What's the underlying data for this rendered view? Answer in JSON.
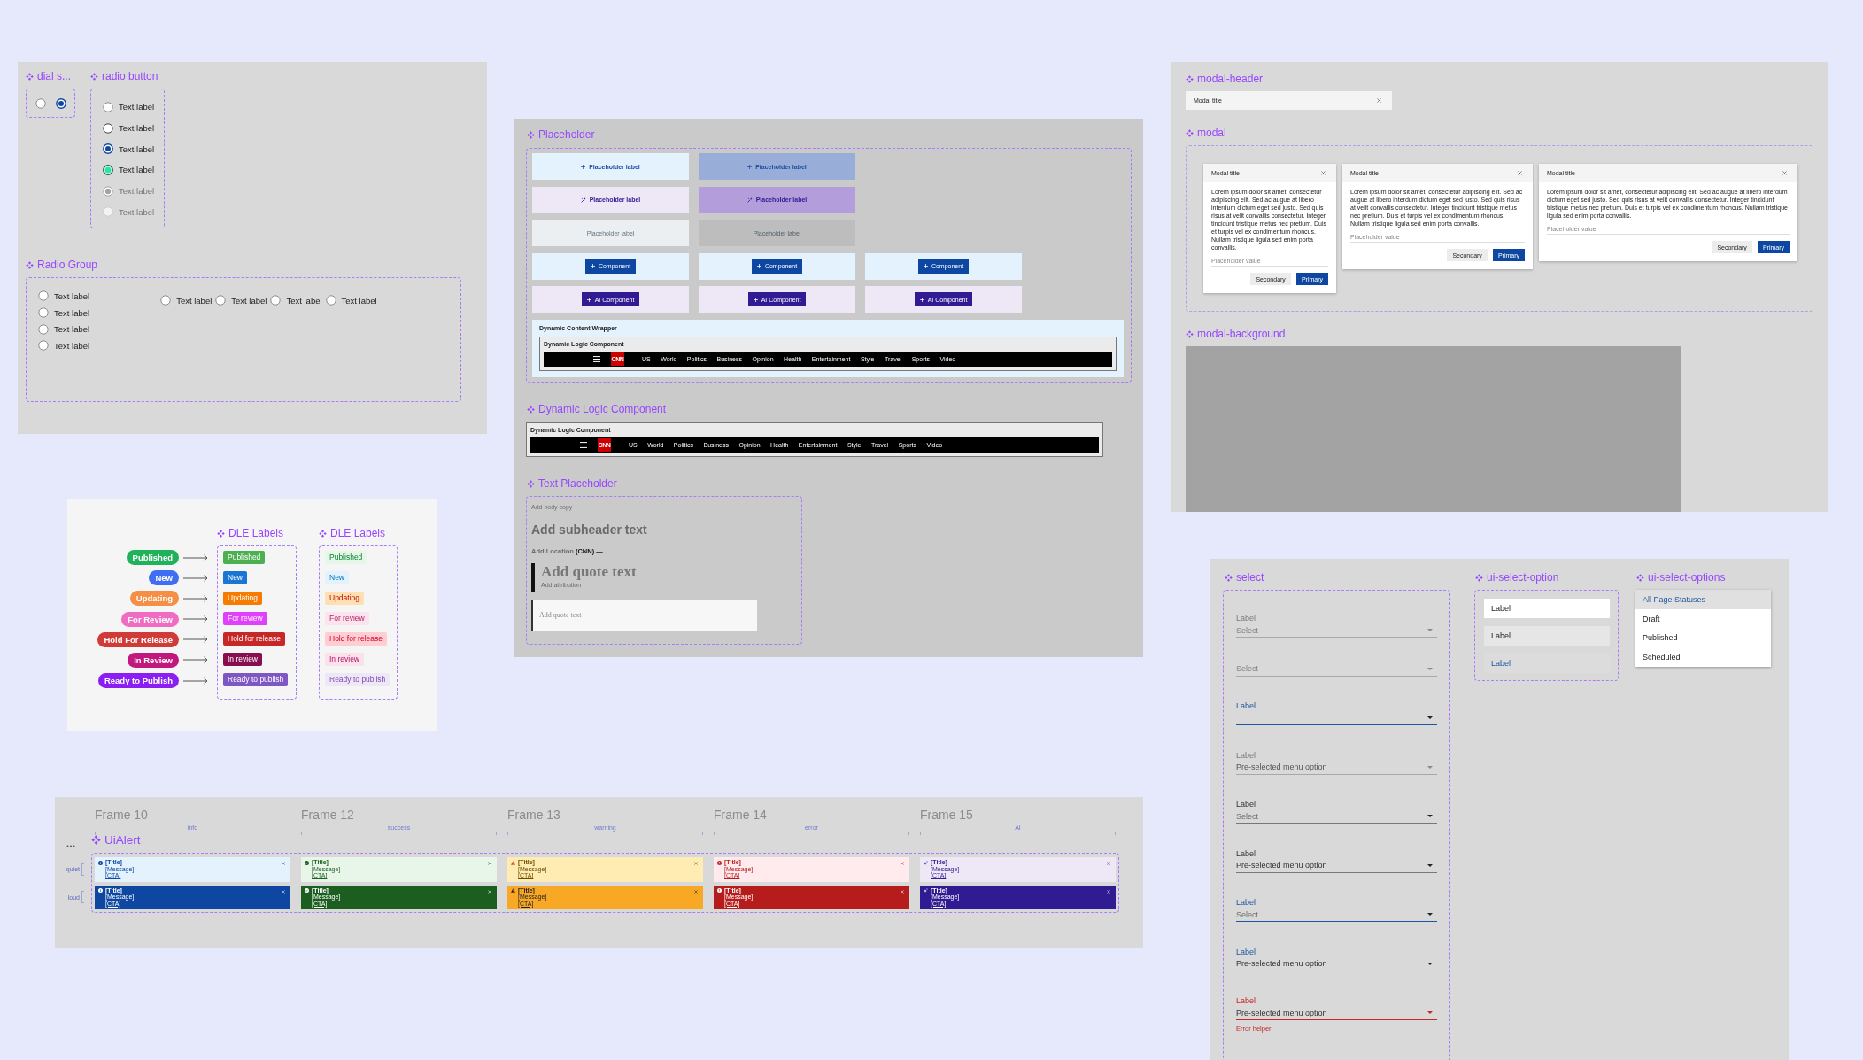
{
  "radio_frame": {
    "dial": {
      "title": "dial s...",
      "radios": [
        {
          "selected": false
        },
        {
          "selected": true
        }
      ]
    },
    "radio_button": {
      "title": "radio button",
      "items": [
        {
          "label": "Text label",
          "kind": "default",
          "selected": false,
          "disabled": false
        },
        {
          "label": "Text label",
          "kind": "hover",
          "selected": false,
          "disabled": false
        },
        {
          "label": "Text label",
          "kind": "default",
          "selected": true,
          "disabled": false
        },
        {
          "label": "Text label",
          "kind": "success",
          "selected": true,
          "disabled": false
        },
        {
          "label": "Text label",
          "kind": "default",
          "selected": true,
          "disabled": true
        },
        {
          "label": "Text label",
          "kind": "default",
          "selected": false,
          "disabled": true
        }
      ]
    },
    "radio_group": {
      "title": "Radio Group",
      "vertical": [
        {
          "label": "Text label",
          "selected": false
        },
        {
          "label": "Text label",
          "selected": false
        },
        {
          "label": "Text label",
          "selected": false
        },
        {
          "label": "Text label",
          "selected": false
        }
      ],
      "horizontal": [
        {
          "label": "Text label",
          "selected": false
        },
        {
          "label": "Text label",
          "selected": false
        },
        {
          "label": "Text label",
          "selected": false
        },
        {
          "label": "Text label",
          "selected": false
        }
      ]
    }
  },
  "modal_frame": {
    "header_section": {
      "title": "modal-header",
      "header": {
        "title": "Modal title"
      }
    },
    "modal_section": {
      "title": "modal",
      "modals": [
        {
          "title": "Modal title",
          "body": "Lorem ipsum dolor sit amet, consectetur adipiscing elit. Sed ac augue at libero interdum dictum eget sed justo. Sed quis risus at velit convallis consectetur. Integer tincidunt tristique metus nec pretium. Duis et turpis vel ex condimentum rhoncus. Nullam tristique ligula sed enim porta convallis.",
          "field": {
            "placeholder": "Placeholder value"
          },
          "buttons": [
            {
              "label": "Secondary",
              "kind": "secondary"
            },
            {
              "label": "Primary",
              "kind": "primary"
            }
          ]
        },
        {
          "title": "Modal title",
          "body": "Lorem ipsum dolor sit amet, consectetur adipiscing elit. Sed ac augue at libero interdum dictum eget sed justo. Sed quis risus at velit convallis consectetur. Integer tincidunt tristique metus nec pretium. Duis et turpis vel ex condimentum rhoncus. Nullam tristique ligula sed enim porta convallis.",
          "field": {
            "placeholder": "Placeholder value"
          },
          "buttons": [
            {
              "label": "Secondary",
              "kind": "secondary"
            },
            {
              "label": "Primary",
              "kind": "primary"
            }
          ]
        },
        {
          "title": "Modal title",
          "body": "Lorem ipsum dolor sit amet, consectetur adipiscing elit. Sed ac augue at libero interdum dictum eget sed justo. Sed quis risus at velit convallis consectetur. Integer tincidunt tristique metus nec pretium. Duis et turpis vel ex condimentum rhoncus. Nullam tristique ligula sed enim porta convallis.",
          "field": {
            "placeholder": "Placeholder value"
          },
          "buttons": [
            {
              "label": "Secondary",
              "kind": "secondary"
            },
            {
              "label": "Primary",
              "kind": "primary"
            }
          ]
        }
      ]
    },
    "background_section": {
      "title": "modal-background"
    }
  },
  "placeholder_frame": {
    "placeholder": {
      "title": "Placeholder",
      "rows": [
        [
          {
            "kind": "add",
            "label": "Placeholder label",
            "active": false
          },
          {
            "kind": "add",
            "label": "Placeholder label",
            "active": true
          }
        ],
        [
          {
            "kind": "ai",
            "label": "Placeholder label",
            "active": false
          },
          {
            "kind": "ai",
            "label": "Placeholder label",
            "active": true
          }
        ],
        [
          {
            "kind": "plain",
            "label": "Placeholder label",
            "active": false
          },
          {
            "kind": "plain",
            "label": "Placeholder label",
            "active": true
          }
        ],
        [
          {
            "kind": "component",
            "label": "Component",
            "active": false
          },
          {
            "kind": "component",
            "label": "Component",
            "active": false
          },
          {
            "kind": "component",
            "label": "Component",
            "active": false
          }
        ],
        [
          {
            "kind": "ai-component",
            "label": "AI Component",
            "active": false
          },
          {
            "kind": "ai-component",
            "label": "AI Component",
            "active": false
          },
          {
            "kind": "ai-component",
            "label": "AI Component",
            "active": false
          }
        ]
      ],
      "wrapper": {
        "title": "Dynamic Content Wrapper",
        "component": {
          "title": "Dynamic Logic Component",
          "logo": "CNN",
          "nav": [
            "US",
            "World",
            "Politics",
            "Business",
            "Opinion",
            "Health",
            "Entertainment",
            "Style",
            "Travel",
            "Sports",
            "Video"
          ]
        }
      }
    },
    "dynamic_logic": {
      "title": "Dynamic Logic Component",
      "component": {
        "title": "Dynamic Logic Component",
        "logo": "CNN",
        "nav": [
          "US",
          "World",
          "Politics",
          "Business",
          "Opinion",
          "Health",
          "Entertainment",
          "Style",
          "Travel",
          "Sports",
          "Video"
        ]
      }
    },
    "text_placeholder": {
      "title": "Text Placeholder",
      "body": {
        "placeholder": "Add body copy"
      },
      "subheader": {
        "placeholder": "Add subheader text"
      },
      "location": {
        "placeholder": "Add Location"
      },
      "dateline": "(CNN) —",
      "quote": {
        "placeholder": "Add quote text"
      },
      "attribution": {
        "placeholder": "Add attribution"
      },
      "quote_field": {
        "placeholder": "Add quote text"
      }
    }
  },
  "status_labels": {
    "pills": [
      {
        "label": "Published",
        "color": "#1fb25a"
      },
      {
        "label": "New",
        "color": "#3f6ef3"
      },
      {
        "label": "Updating",
        "color": "#f58f45"
      },
      {
        "label": "For Review",
        "color": "#f06cc3"
      },
      {
        "label": "Hold For Release",
        "color": "#d03a37"
      },
      {
        "label": "In Review",
        "color": "#c2187e"
      },
      {
        "label": "Ready to Publish",
        "color": "#8b1ef2"
      }
    ],
    "groups": [
      {
        "title": "DLE Labels",
        "kind": "solid",
        "labels": [
          {
            "label": "Published",
            "color": "#4caf50"
          },
          {
            "label": "New",
            "color": "#1976d2"
          },
          {
            "label": "Updating",
            "color": "#f57c00"
          },
          {
            "label": "For review",
            "color": "#e040fb"
          },
          {
            "label": "Hold for release",
            "color": "#c62828"
          },
          {
            "label": "In review",
            "color": "#880e4f"
          },
          {
            "label": "Ready to publish",
            "color": "#7e57c2"
          }
        ]
      },
      {
        "title": "DLE Labels",
        "kind": "subtle",
        "labels": [
          {
            "label": "Published",
            "color": "#e8f5e9"
          },
          {
            "label": "New",
            "color": "#e3f2fd"
          },
          {
            "label": "Updating",
            "color": "#ffe0b2"
          },
          {
            "label": "For review",
            "color": "#fce4ec"
          },
          {
            "label": "Hold for release",
            "color": "#ffcdd2"
          },
          {
            "label": "In review",
            "color": "#fbe1ea"
          },
          {
            "label": "Ready to publish",
            "color": "#ede7f6"
          }
        ]
      }
    ]
  },
  "select_frame": {
    "select": {
      "title": "select",
      "fields": [
        {
          "label": "Label",
          "placeholder": "Select",
          "disabled": true,
          "focused": false,
          "error": false
        },
        {
          "placeholder": "Select",
          "disabled": true,
          "focused": false,
          "error": false
        },
        {
          "label": "Label",
          "disabled": false,
          "focused": true,
          "error": false
        },
        {
          "label": "Label",
          "value": "Pre-selected menu option",
          "disabled": true,
          "focused": false,
          "error": false
        },
        {
          "label": "Label",
          "placeholder": "Select",
          "disabled": false,
          "focused": false,
          "error": false
        },
        {
          "label": "Label",
          "value": "Pre-selected menu option",
          "disabled": false,
          "focused": false,
          "error": false
        },
        {
          "label": "Label",
          "placeholder": "Select",
          "disabled": false,
          "focused": true,
          "error": false
        },
        {
          "label": "Label",
          "value": "Pre-selected menu option",
          "disabled": false,
          "focused": true,
          "error": false
        },
        {
          "label": "Label",
          "value": "Pre-selected menu option",
          "disabled": false,
          "focused": false,
          "error": true,
          "helper": "Error helper"
        }
      ]
    },
    "option": {
      "title": "ui-select-option",
      "options": [
        {
          "label": "Label",
          "selected": false,
          "hovered": false
        },
        {
          "label": "Label",
          "selected": false,
          "hovered": true
        },
        {
          "label": "Label",
          "selected": true,
          "hovered": false
        }
      ]
    },
    "options": {
      "title": "ui-select-options",
      "items": [
        {
          "label": "All Page Statuses",
          "selected": true
        },
        {
          "label": "Draft",
          "selected": false
        },
        {
          "label": "Published",
          "selected": false
        },
        {
          "label": "Scheduled",
          "selected": false
        }
      ]
    }
  },
  "alerts_frame": {
    "frames": [
      {
        "title": "Frame 10",
        "tag": "info"
      },
      {
        "title": "Frame 12",
        "tag": "success"
      },
      {
        "title": "Frame 13",
        "tag": "warning"
      },
      {
        "title": "Frame 14",
        "tag": "error"
      },
      {
        "title": "Frame 15",
        "tag": "AI"
      }
    ],
    "title": "UiAlert",
    "rows": [
      {
        "label": "quiet",
        "kind": "quiet",
        "alerts": [
          {
            "kind": "info",
            "title": "[Title]",
            "message": "[Message]",
            "cta": "[CTA]"
          },
          {
            "kind": "success",
            "title": "[Title]",
            "message": "[Message]",
            "cta": "[CTA]"
          },
          {
            "kind": "warning",
            "title": "[Title]",
            "message": "[Message]",
            "cta": "[CTA]"
          },
          {
            "kind": "error",
            "title": "[Title]",
            "message": "[Message]",
            "cta": "[CTA]"
          },
          {
            "kind": "ai",
            "title": "[Title]",
            "message": "[Message]",
            "cta": "[CTA]"
          }
        ]
      },
      {
        "label": "loud",
        "kind": "loud",
        "alerts": [
          {
            "kind": "info",
            "title": "[Title]",
            "message": "[Message]",
            "cta": "[CTA]"
          },
          {
            "kind": "success",
            "title": "[Title]",
            "message": "[Message]",
            "cta": "[CTA]"
          },
          {
            "kind": "warning",
            "title": "[Title]",
            "message": "[Message]",
            "cta": "[CTA]"
          },
          {
            "kind": "error",
            "title": "[Title]",
            "message": "[Message]",
            "cta": "[CTA]"
          },
          {
            "kind": "ai",
            "title": "[Title]",
            "message": "[Message]",
            "cta": "[CTA]"
          }
        ]
      }
    ]
  }
}
